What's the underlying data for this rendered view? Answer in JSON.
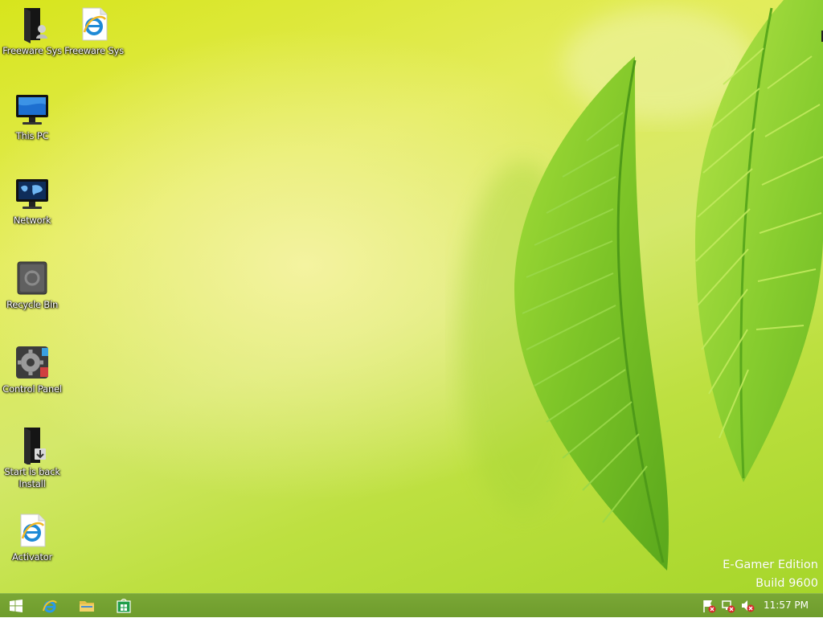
{
  "desktop": {
    "icons": [
      {
        "label": "Freeware Sys",
        "icon": "folder-user-icon"
      },
      {
        "label": "Freeware Sys",
        "icon": "ie-document-icon"
      },
      {
        "label": "This PC",
        "icon": "monitor-icon"
      },
      {
        "label": "Network",
        "icon": "network-monitor-icon"
      },
      {
        "label": "Recycle Bin",
        "icon": "recycle-bin-icon"
      },
      {
        "label": "Control Panel",
        "icon": "control-panel-icon"
      },
      {
        "label": "Start is back Install",
        "icon": "installer-icon"
      },
      {
        "label": "Activator",
        "icon": "ie-document-icon"
      }
    ],
    "watermark": {
      "edition": "E-Gamer Edition",
      "build": "Build 9600"
    }
  },
  "taskbar": {
    "pinned": [
      "start-icon",
      "internet-explorer-icon",
      "file-explorer-icon",
      "store-icon"
    ],
    "tray": [
      "action-center-flag-icon",
      "network-error-icon",
      "volume-muted-icon"
    ],
    "clock": "11:57 PM"
  },
  "colors": {
    "taskbar": "#76a331",
    "wallpaper": "#d7e51c",
    "leaf": "#7fc22a"
  }
}
